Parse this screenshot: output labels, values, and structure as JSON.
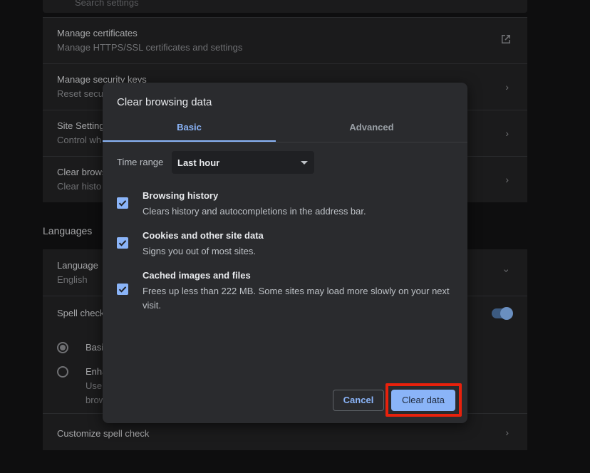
{
  "background": {
    "search_placeholder": "Search settings",
    "rows": [
      {
        "title": "Manage certificates",
        "subtitle": "Manage HTTPS/SSL certificates and settings"
      },
      {
        "title": "Manage security keys",
        "subtitle": "Reset secu"
      },
      {
        "title": "Site Setting",
        "subtitle": "Control wh"
      },
      {
        "title": "Clear brows",
        "subtitle": "Clear histo"
      }
    ],
    "languages_section_title": "Languages",
    "language_row": {
      "title": "Language",
      "subtitle": "English"
    },
    "spell_check_label": "Spell check",
    "spell_basic_label": "Basi",
    "spell_enhanced": {
      "title": "Enha",
      "line1": "Use",
      "line2": "brow"
    },
    "customize_spell_check": "Customize spell check"
  },
  "dialog": {
    "title": "Clear browsing data",
    "tabs": [
      {
        "label": "Basic",
        "active": true
      },
      {
        "label": "Advanced",
        "active": false
      }
    ],
    "time_range": {
      "label": "Time range",
      "value": "Last hour"
    },
    "items": [
      {
        "title": "Browsing history",
        "description": "Clears history and autocompletions in the address bar.",
        "checked": true
      },
      {
        "title": "Cookies and other site data",
        "description": "Signs you out of most sites.",
        "checked": true
      },
      {
        "title": "Cached images and files",
        "description": "Frees up less than 222 MB. Some sites may load more slowly on your next visit.",
        "checked": true
      }
    ],
    "cancel_label": "Cancel",
    "clear_label": "Clear data"
  },
  "colors": {
    "accent": "#8ab4f8",
    "highlight": "#e8210c",
    "dialog_bg": "#2a2b2e"
  }
}
